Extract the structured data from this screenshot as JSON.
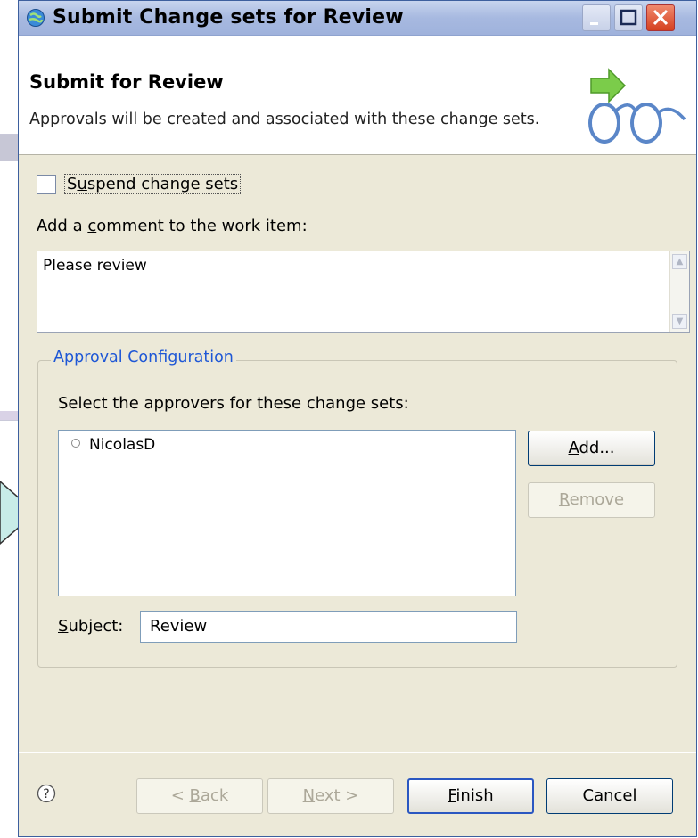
{
  "window": {
    "title": "Submit Change sets for Review",
    "controls": [
      "minimize",
      "maximize",
      "close"
    ]
  },
  "header": {
    "title": "Submit for Review",
    "description": "Approvals will be created and associated with these change sets."
  },
  "form": {
    "suspend_checkbox": {
      "label_pre": "S",
      "label_mnemonic": "u",
      "label_post": "spend change sets",
      "checked": false
    },
    "comment_label_pre": "Add a ",
    "comment_label_mnemonic": "c",
    "comment_label_post": "omment to the work item:",
    "comment_value": "Please review"
  },
  "approval": {
    "group_title": "Approval Configuration",
    "approvers_label": "Select the approvers for these change sets:",
    "approvers": [
      "NicolasD"
    ],
    "add_button": {
      "mnemonic": "A",
      "rest": "dd..."
    },
    "remove_button": {
      "mnemonic": "R",
      "rest": "emove",
      "enabled": false
    },
    "subject_label": {
      "mnemonic": "S",
      "rest": "ubject:"
    },
    "subject_value": "Review"
  },
  "footer": {
    "back_button": {
      "pre": "< ",
      "mnemonic": "B",
      "rest": "ack",
      "enabled": false
    },
    "next_button": {
      "mnemonic": "N",
      "rest": "ext >",
      "enabled": false
    },
    "finish_button": {
      "mnemonic": "F",
      "rest": "inish"
    },
    "cancel_button": {
      "label": "Cancel"
    }
  },
  "colors": {
    "dialog_bg": "#ece9d8",
    "group_title": "#1e57d6",
    "close_button": "#d5401f",
    "callout_fill": "#c8ece8"
  }
}
